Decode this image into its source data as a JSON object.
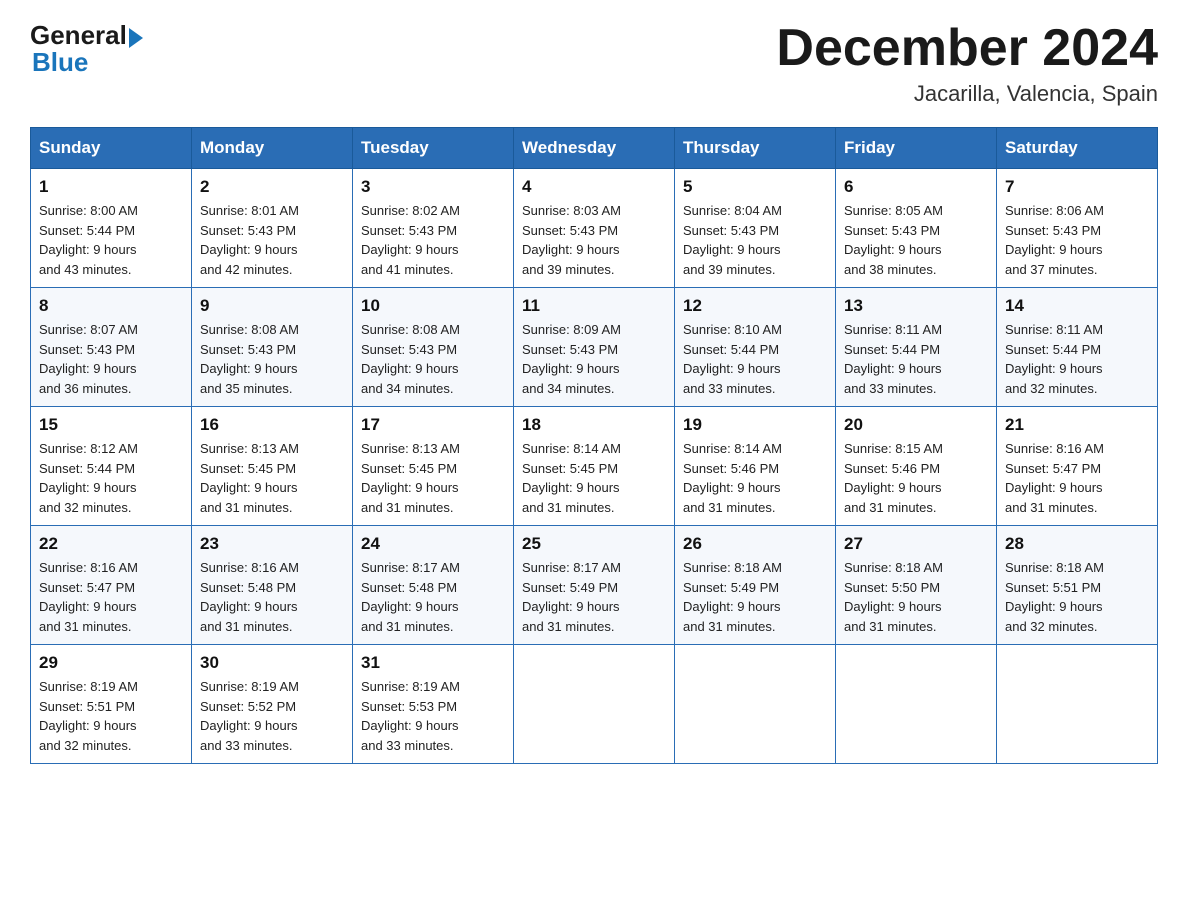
{
  "header": {
    "logo_general": "General",
    "logo_blue": "Blue",
    "month_title": "December 2024",
    "location": "Jacarilla, Valencia, Spain"
  },
  "weekdays": [
    "Sunday",
    "Monday",
    "Tuesday",
    "Wednesday",
    "Thursday",
    "Friday",
    "Saturday"
  ],
  "weeks": [
    [
      {
        "day": "1",
        "sunrise": "8:00 AM",
        "sunset": "5:44 PM",
        "daylight": "9 hours and 43 minutes."
      },
      {
        "day": "2",
        "sunrise": "8:01 AM",
        "sunset": "5:43 PM",
        "daylight": "9 hours and 42 minutes."
      },
      {
        "day": "3",
        "sunrise": "8:02 AM",
        "sunset": "5:43 PM",
        "daylight": "9 hours and 41 minutes."
      },
      {
        "day": "4",
        "sunrise": "8:03 AM",
        "sunset": "5:43 PM",
        "daylight": "9 hours and 39 minutes."
      },
      {
        "day": "5",
        "sunrise": "8:04 AM",
        "sunset": "5:43 PM",
        "daylight": "9 hours and 39 minutes."
      },
      {
        "day": "6",
        "sunrise": "8:05 AM",
        "sunset": "5:43 PM",
        "daylight": "9 hours and 38 minutes."
      },
      {
        "day": "7",
        "sunrise": "8:06 AM",
        "sunset": "5:43 PM",
        "daylight": "9 hours and 37 minutes."
      }
    ],
    [
      {
        "day": "8",
        "sunrise": "8:07 AM",
        "sunset": "5:43 PM",
        "daylight": "9 hours and 36 minutes."
      },
      {
        "day": "9",
        "sunrise": "8:08 AM",
        "sunset": "5:43 PM",
        "daylight": "9 hours and 35 minutes."
      },
      {
        "day": "10",
        "sunrise": "8:08 AM",
        "sunset": "5:43 PM",
        "daylight": "9 hours and 34 minutes."
      },
      {
        "day": "11",
        "sunrise": "8:09 AM",
        "sunset": "5:43 PM",
        "daylight": "9 hours and 34 minutes."
      },
      {
        "day": "12",
        "sunrise": "8:10 AM",
        "sunset": "5:44 PM",
        "daylight": "9 hours and 33 minutes."
      },
      {
        "day": "13",
        "sunrise": "8:11 AM",
        "sunset": "5:44 PM",
        "daylight": "9 hours and 33 minutes."
      },
      {
        "day": "14",
        "sunrise": "8:11 AM",
        "sunset": "5:44 PM",
        "daylight": "9 hours and 32 minutes."
      }
    ],
    [
      {
        "day": "15",
        "sunrise": "8:12 AM",
        "sunset": "5:44 PM",
        "daylight": "9 hours and 32 minutes."
      },
      {
        "day": "16",
        "sunrise": "8:13 AM",
        "sunset": "5:45 PM",
        "daylight": "9 hours and 31 minutes."
      },
      {
        "day": "17",
        "sunrise": "8:13 AM",
        "sunset": "5:45 PM",
        "daylight": "9 hours and 31 minutes."
      },
      {
        "day": "18",
        "sunrise": "8:14 AM",
        "sunset": "5:45 PM",
        "daylight": "9 hours and 31 minutes."
      },
      {
        "day": "19",
        "sunrise": "8:14 AM",
        "sunset": "5:46 PM",
        "daylight": "9 hours and 31 minutes."
      },
      {
        "day": "20",
        "sunrise": "8:15 AM",
        "sunset": "5:46 PM",
        "daylight": "9 hours and 31 minutes."
      },
      {
        "day": "21",
        "sunrise": "8:16 AM",
        "sunset": "5:47 PM",
        "daylight": "9 hours and 31 minutes."
      }
    ],
    [
      {
        "day": "22",
        "sunrise": "8:16 AM",
        "sunset": "5:47 PM",
        "daylight": "9 hours and 31 minutes."
      },
      {
        "day": "23",
        "sunrise": "8:16 AM",
        "sunset": "5:48 PM",
        "daylight": "9 hours and 31 minutes."
      },
      {
        "day": "24",
        "sunrise": "8:17 AM",
        "sunset": "5:48 PM",
        "daylight": "9 hours and 31 minutes."
      },
      {
        "day": "25",
        "sunrise": "8:17 AM",
        "sunset": "5:49 PM",
        "daylight": "9 hours and 31 minutes."
      },
      {
        "day": "26",
        "sunrise": "8:18 AM",
        "sunset": "5:49 PM",
        "daylight": "9 hours and 31 minutes."
      },
      {
        "day": "27",
        "sunrise": "8:18 AM",
        "sunset": "5:50 PM",
        "daylight": "9 hours and 31 minutes."
      },
      {
        "day": "28",
        "sunrise": "8:18 AM",
        "sunset": "5:51 PM",
        "daylight": "9 hours and 32 minutes."
      }
    ],
    [
      {
        "day": "29",
        "sunrise": "8:19 AM",
        "sunset": "5:51 PM",
        "daylight": "9 hours and 32 minutes."
      },
      {
        "day": "30",
        "sunrise": "8:19 AM",
        "sunset": "5:52 PM",
        "daylight": "9 hours and 33 minutes."
      },
      {
        "day": "31",
        "sunrise": "8:19 AM",
        "sunset": "5:53 PM",
        "daylight": "9 hours and 33 minutes."
      },
      null,
      null,
      null,
      null
    ]
  ],
  "labels": {
    "sunrise": "Sunrise:",
    "sunset": "Sunset:",
    "daylight": "Daylight:"
  }
}
